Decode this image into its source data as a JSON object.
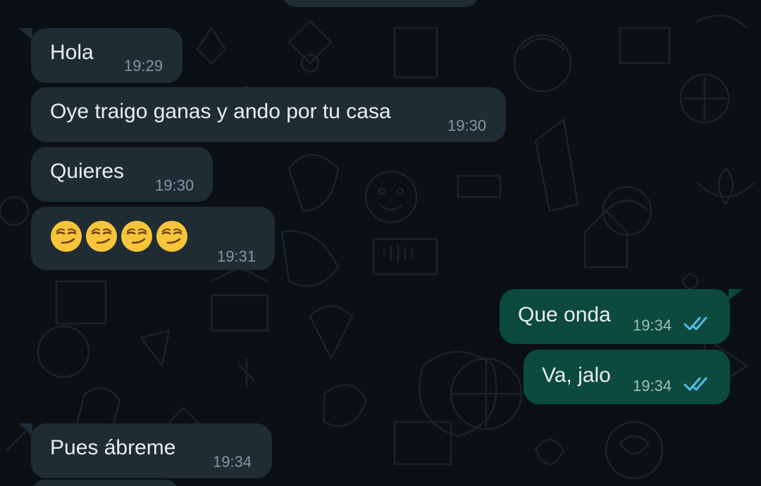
{
  "colors": {
    "incoming_bubble": "#1f2c34",
    "outgoing_bubble": "#0b4a3c",
    "background": "#0b1014",
    "read_ticks": "#53bdeb"
  },
  "messages": [
    {
      "direction": "incoming",
      "text": "Hola",
      "time": "19:29"
    },
    {
      "direction": "incoming",
      "text": "Oye traigo ganas y ando por tu casa",
      "time": "19:30"
    },
    {
      "direction": "incoming",
      "text": "Quieres",
      "time": "19:30"
    },
    {
      "direction": "incoming",
      "emoji": "smirking-face",
      "emoji_count": 4,
      "time": "19:31"
    },
    {
      "direction": "outgoing",
      "text": "Que onda",
      "time": "19:34",
      "status": "read"
    },
    {
      "direction": "outgoing",
      "text": "Va, jalo",
      "time": "19:34",
      "status": "read"
    },
    {
      "direction": "incoming",
      "text": "Pues ábreme",
      "time": "19:34"
    }
  ]
}
